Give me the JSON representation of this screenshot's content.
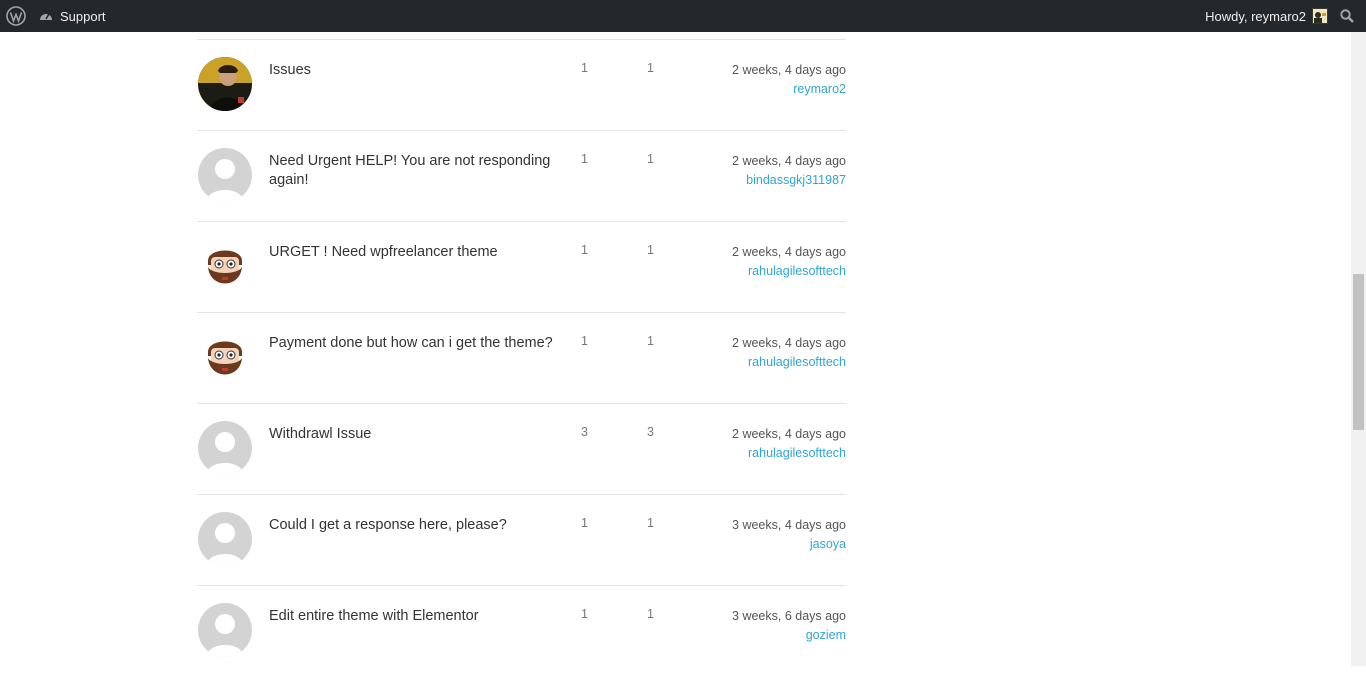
{
  "adminbar": {
    "site_name": "Support",
    "howdy": "Howdy, reymaro2",
    "icons": {
      "logo": "wordpress-logo-icon",
      "site": "dashboard-icon",
      "search": "search-icon"
    }
  },
  "topics": [
    {
      "title": "Issues",
      "col1": "1",
      "col2": "1",
      "time": "2 weeks, 4 days ago",
      "author": "reymaro2",
      "avatar": "photo"
    },
    {
      "title": "Need Urgent HELP! You are not responding again!",
      "col1": "1",
      "col2": "1",
      "time": "2 weeks, 4 days ago",
      "author": "bindassgkj311987",
      "avatar": "default"
    },
    {
      "title": "URGET ! Need wpfreelancer theme",
      "col1": "1",
      "col2": "1",
      "time": "2 weeks, 4 days ago",
      "author": "rahulagilesofttech",
      "avatar": "beard"
    },
    {
      "title": "Payment done but how can i get the theme?",
      "col1": "1",
      "col2": "1",
      "time": "2 weeks, 4 days ago",
      "author": "rahulagilesofttech",
      "avatar": "beard"
    },
    {
      "title": "Withdrawl Issue",
      "col1": "3",
      "col2": "3",
      "time": "2 weeks, 4 days ago",
      "author": "rahulagilesofttech",
      "avatar": "default"
    },
    {
      "title": "Could I get a response here, please?",
      "col1": "1",
      "col2": "1",
      "time": "3 weeks, 4 days ago",
      "author": "jasoya",
      "avatar": "default"
    },
    {
      "title": "Edit entire theme with Elementor",
      "col1": "1",
      "col2": "1",
      "time": "3 weeks, 6 days ago",
      "author": "goziem",
      "avatar": "default"
    }
  ]
}
